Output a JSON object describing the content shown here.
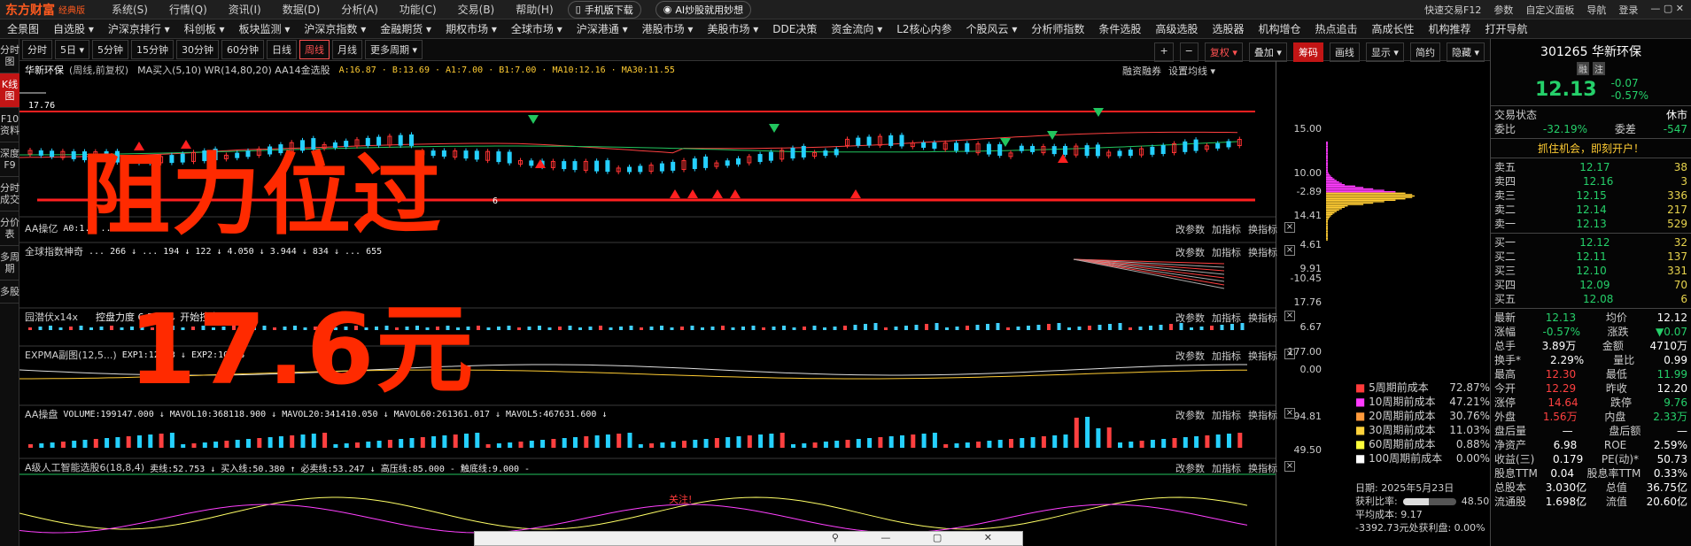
{
  "app": {
    "logo": "东方财富",
    "edition": "经典版",
    "menus": [
      "系统(S)",
      "行情(Q)",
      "资讯(I)",
      "数据(D)",
      "分析(A)",
      "功能(C)",
      "交易(B)",
      "帮助(H)"
    ],
    "mobile_download": "手机版下载",
    "ai_promo": "AI炒股就用妙想",
    "quick_trade": "快速交易F12",
    "right_tools": [
      "参数",
      "自定义面板",
      "导航",
      "登录"
    ]
  },
  "nav": [
    "全景图",
    "自选股 ▾",
    "沪深京排行 ▾",
    "科创板 ▾",
    "板块监测 ▾",
    "沪深京指数 ▾",
    "金融期货 ▾",
    "期权市场 ▾",
    "全球市场 ▾",
    "沪深港通 ▾",
    "港股市场 ▾",
    "美股市场 ▾",
    "DDE决策",
    "资金流向 ▾",
    "L2核心内参",
    "个股风云 ▾",
    "分析师指数",
    "条件选股",
    "高级选股",
    "选股器",
    "机构增仓",
    "热点追击",
    "高成长性",
    "机构推荐",
    "打开导航"
  ],
  "left_tabs": [
    "分时图",
    "K线图",
    "F10资料",
    "深度F9",
    "分时成交",
    "分价表",
    "多周期",
    "多股"
  ],
  "periods": [
    "分时",
    "5日 ▾",
    "5分钟",
    "15分钟",
    "30分钟",
    "60分钟",
    "日线",
    "周线",
    "月线",
    "更多周期 ▾"
  ],
  "active_period": "周线",
  "period_tools": [
    "+",
    "−",
    "复权 ▾",
    "叠加 ▾",
    "筹码",
    "画线",
    "显示 ▾",
    "简约",
    "隐藏 ▾"
  ],
  "main_panel": {
    "stock": "华新环保",
    "mode": "(周线,前复权)",
    "indicators": "MA买入(5,10)  WR(14,80,20)  AA14金选股",
    "values": "A:16.87 · B:13.69 · A1:7.00 · B1:7.00 · MA10:12.16 · MA30:11.55",
    "tools": [
      "融资融券",
      "设置均线 ▾"
    ],
    "high_label": "17.76",
    "low_label": "6",
    "y_labels": [
      "15.00",
      "10.00"
    ]
  },
  "sub_panels": [
    {
      "name": "AA操亿",
      "values": "A0:1.2 ... 058",
      "y": [
        "-2.89"
      ]
    },
    {
      "name": "全球指数神奇",
      "values": "... 266 ↓ ... 194 ↓ 122 ↓ 4.050 ↓ 3.944 ↓ 834 ↓ ... 655",
      "y": [
        "14.41",
        "4.61"
      ]
    },
    {
      "name": "园潜伏x14x",
      "values": "控盘力度 6.588 ↓ 开始控盘:0.000 -",
      "y": [
        "9.91",
        "-10.45"
      ]
    },
    {
      "name": "EXPMA副图(12,5...)",
      "values": "EXP1:12.13 ↓ EXP2:10.98",
      "y": [
        "17.76",
        "6.67"
      ]
    },
    {
      "name": "AA操盘",
      "values": "VOLUME:199147.000 ↓ MAVOL10:368118.900 ↓ MAVOL20:341410.050 ↓ MAVOL60:261361.017 ↓ MAVOL5:467631.600 ↓",
      "y": [
        "177.00",
        "0.00"
      ]
    },
    {
      "name": "A级人工智能选股6(18,8,4)",
      "values": "卖线:52.753 ↓ 买入线:50.380 ↑ 必卖线:53.247 ↓ 高压线:85.000 - 触底线:9.000 -",
      "y": [
        "94.81",
        "49.50"
      ]
    }
  ],
  "panel_buttons": [
    "改参数",
    "加指标",
    "换指标"
  ],
  "attention_label": "关注!",
  "overlay": {
    "line1": "阻力位过",
    "line2": "17.6元"
  },
  "cost_distribution": [
    {
      "label": "5周期前成本",
      "value": "72.87%",
      "color": "#ff3b3b"
    },
    {
      "label": "10周期前成本",
      "value": "47.21%",
      "color": "#ff3bff"
    },
    {
      "label": "20周期前成本",
      "value": "30.76%",
      "color": "#ff9a3b"
    },
    {
      "label": "30周期前成本",
      "value": "11.03%",
      "color": "#ffd23b"
    },
    {
      "label": "60周期前成本",
      "value": "0.88%",
      "color": "#ffff3b"
    },
    {
      "label": "100周期前成本",
      "value": "0.00%",
      "color": "#ffffff"
    }
  ],
  "chip_summary": {
    "date": "日期: 2025年5月23日",
    "profit_ratio_label": "获利比率:",
    "profit_ratio": "48.50%",
    "profit_ratio_frac": 0.485,
    "avg_cost": "平均成本: 9.17",
    "note": "-3392.73元处获利盘: 0.00%"
  },
  "quote": {
    "code": "301265",
    "name": "华新环保",
    "badges": [
      "融",
      "注"
    ],
    "price": "12.13",
    "change": "-0.07",
    "change_pct": "-0.57%",
    "trade_status_label": "交易状态",
    "trade_status": "休市",
    "weibi_label": "委比",
    "weibi": "-32.19%",
    "weicha_label": "委差",
    "weicha": "-547",
    "promo": "抓住机会，即刻开户！",
    "asks": [
      {
        "label": "卖五",
        "price": "12.17",
        "vol": "38"
      },
      {
        "label": "卖四",
        "price": "12.16",
        "vol": "3"
      },
      {
        "label": "卖三",
        "price": "12.15",
        "vol": "336"
      },
      {
        "label": "卖二",
        "price": "12.14",
        "vol": "217"
      },
      {
        "label": "卖一",
        "price": "12.13",
        "vol": "529"
      }
    ],
    "bids": [
      {
        "label": "买一",
        "price": "12.12",
        "vol": "32"
      },
      {
        "label": "买二",
        "price": "12.11",
        "vol": "137"
      },
      {
        "label": "买三",
        "price": "12.10",
        "vol": "331"
      },
      {
        "label": "买四",
        "price": "12.09",
        "vol": "70"
      },
      {
        "label": "买五",
        "price": "12.08",
        "vol": "6"
      }
    ],
    "stats": [
      [
        "最新",
        "12.13",
        "均价",
        "12.12"
      ],
      [
        "涨幅",
        "-0.57%",
        "涨跌",
        "▼0.07"
      ],
      [
        "总手",
        "3.89万",
        "金额",
        "4710万"
      ],
      [
        "换手*",
        "2.29%",
        "量比",
        "0.99"
      ],
      [
        "最高",
        "12.30",
        "最低",
        "11.99"
      ],
      [
        "今开",
        "12.29",
        "昨收",
        "12.20"
      ],
      [
        "涨停",
        "14.64",
        "跌停",
        "9.76"
      ],
      [
        "外盘",
        "1.56万",
        "内盘",
        "2.33万"
      ],
      [
        "盘后量",
        "—",
        "盘后额",
        "—"
      ],
      [
        "净资产",
        "6.98",
        "ROE",
        "2.59%"
      ],
      [
        "收益(三)",
        "0.179",
        "PE(动)*",
        "50.73"
      ],
      [
        "股息TTM",
        "0.04",
        "股息率TTM",
        "0.33%"
      ],
      [
        "总股本",
        "3.030亿",
        "总值",
        "36.75亿"
      ],
      [
        "流通股",
        "1.698亿",
        "流值",
        "20.60亿"
      ]
    ]
  },
  "colors": {
    "up": "#ff3333",
    "down": "#25d0ff",
    "ma": "#22c55e",
    "resistance": "#ff2020",
    "highlight": "#ff7a1a"
  }
}
